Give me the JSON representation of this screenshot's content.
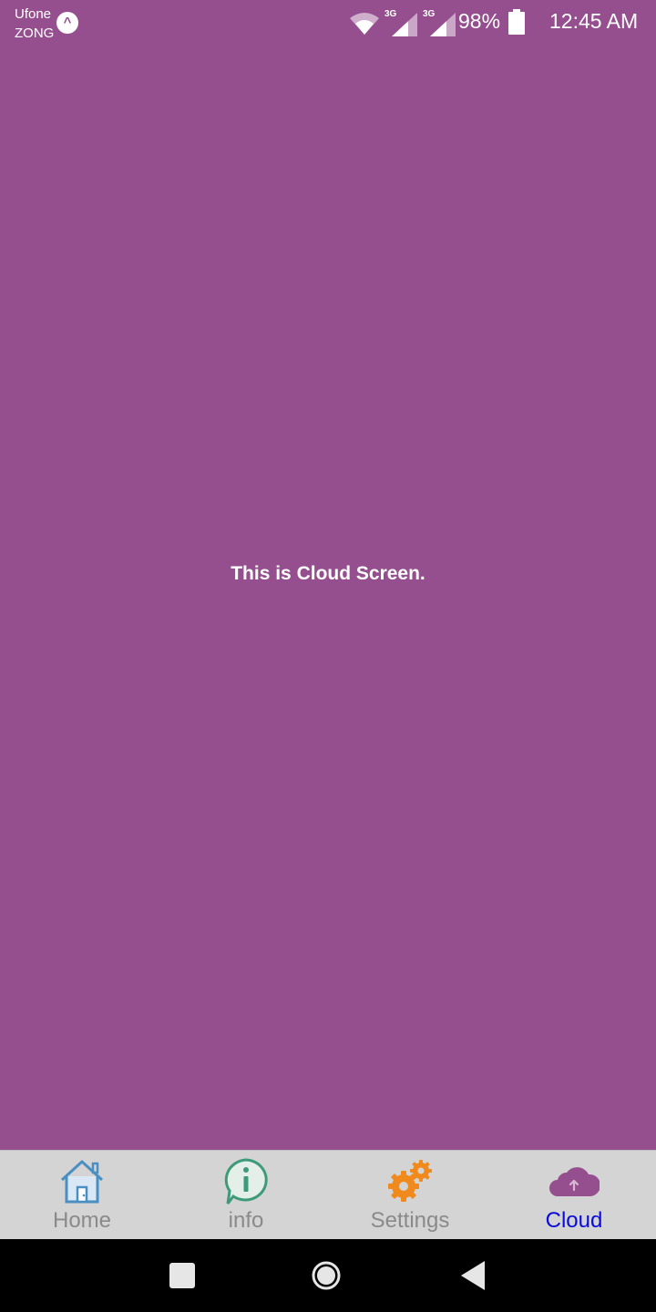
{
  "status_bar": {
    "carrier_1": "Ufone",
    "carrier_2": "ZONG",
    "network_1": "3G",
    "network_2": "3G",
    "battery": "98%",
    "time": "12:45 AM",
    "icons": [
      "alert-icon",
      "wifi-icon",
      "signal-icon",
      "signal-icon",
      "battery-icon"
    ]
  },
  "main": {
    "message": "This is Cloud Screen.",
    "background_color": "#954f8e"
  },
  "tab_bar": {
    "active_color": "#0a0adc",
    "inactive_color": "#8a8a8a",
    "tabs": [
      {
        "label": "Home",
        "icon": "home-icon",
        "active": false
      },
      {
        "label": "info",
        "icon": "info-icon",
        "active": false
      },
      {
        "label": "Settings",
        "icon": "gears-icon",
        "active": false
      },
      {
        "label": "Cloud",
        "icon": "cloud-upload-icon",
        "active": true
      }
    ]
  },
  "nav_bar": {
    "buttons": [
      "recents-button",
      "home-button",
      "back-button"
    ]
  }
}
